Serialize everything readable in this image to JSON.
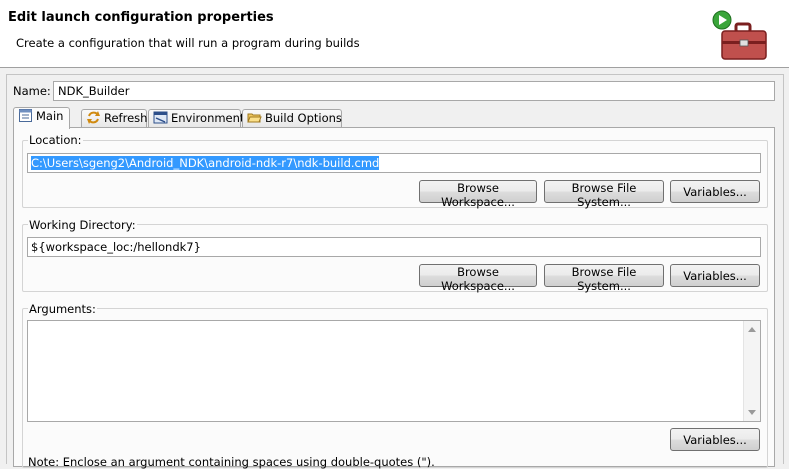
{
  "header": {
    "title": "Edit launch configuration properties",
    "description": "Create a configuration that will run a program during builds",
    "icon": "toolbox-run-icon"
  },
  "name": {
    "label": "Name:",
    "value": "NDK_Builder"
  },
  "tabs": [
    {
      "label": "Main",
      "icon": "main-tab-icon",
      "active": true
    },
    {
      "label": "Refresh",
      "icon": "refresh-icon",
      "active": false
    },
    {
      "label": "Environment",
      "icon": "environment-icon",
      "active": false
    },
    {
      "label": "Build Options",
      "icon": "folder-open-icon",
      "active": false
    }
  ],
  "location": {
    "label": "Location:",
    "value": "C:\\Users\\sgeng2\\Android_NDK\\android-ndk-r7\\ndk-build.cmd",
    "buttons": [
      "Browse Workspace...",
      "Browse File System...",
      "Variables..."
    ]
  },
  "working_directory": {
    "label": "Working Directory:",
    "value": "${workspace_loc:/hellondk7}",
    "buttons": [
      "Browse Workspace...",
      "Browse File System...",
      "Variables..."
    ]
  },
  "arguments": {
    "label": "Arguments:",
    "value": "",
    "variables_button": "Variables..."
  },
  "note_partial": "Note: Enclose an argument containing spaces using double-quotes (\")."
}
